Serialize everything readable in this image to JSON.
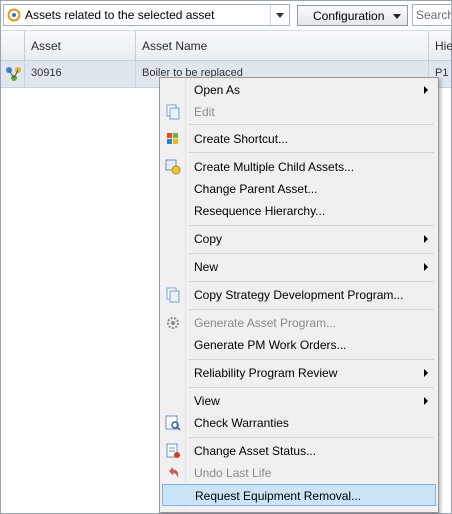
{
  "toolbar": {
    "combo_text": "Assets related to the selected asset",
    "configuration_label": "Configuration",
    "search_placeholder": "Search A"
  },
  "grid": {
    "columns": [
      "",
      "Asset",
      "Asset Name",
      "Hie"
    ],
    "row": {
      "asset": "30916",
      "asset_name": "Boiler to be replaced",
      "hierarchy": "P1"
    }
  },
  "menu": {
    "items": [
      {
        "label": "Open As",
        "submenu": true,
        "disabled": false
      },
      {
        "label": "Edit",
        "submenu": false,
        "disabled": true
      },
      {
        "label": "Create Shortcut...",
        "submenu": false,
        "disabled": false
      },
      {
        "label": "Create Multiple Child Assets...",
        "submenu": false,
        "disabled": false
      },
      {
        "label": "Change Parent Asset...",
        "submenu": false,
        "disabled": false
      },
      {
        "label": "Resequence Hierarchy...",
        "submenu": false,
        "disabled": false
      },
      {
        "label": "Copy",
        "submenu": true,
        "disabled": false
      },
      {
        "label": "New",
        "submenu": true,
        "disabled": false
      },
      {
        "label": "Copy Strategy Development Program...",
        "submenu": false,
        "disabled": false
      },
      {
        "label": "Generate Asset Program...",
        "submenu": false,
        "disabled": true
      },
      {
        "label": "Generate PM Work Orders...",
        "submenu": false,
        "disabled": false
      },
      {
        "label": "Reliability Program Review",
        "submenu": true,
        "disabled": false
      },
      {
        "label": "View",
        "submenu": true,
        "disabled": false
      },
      {
        "label": "Check Warranties",
        "submenu": false,
        "disabled": false
      },
      {
        "label": "Change Asset Status...",
        "submenu": false,
        "disabled": false
      },
      {
        "label": "Undo Last Life",
        "submenu": false,
        "disabled": true
      },
      {
        "label": "Request Equipment Removal...",
        "submenu": false,
        "disabled": false,
        "highlighted": true
      }
    ]
  },
  "colors": {
    "highlight": "#cce4f7",
    "highlight_border": "#7eb4ea",
    "row_selected": "#dfe6ee"
  }
}
